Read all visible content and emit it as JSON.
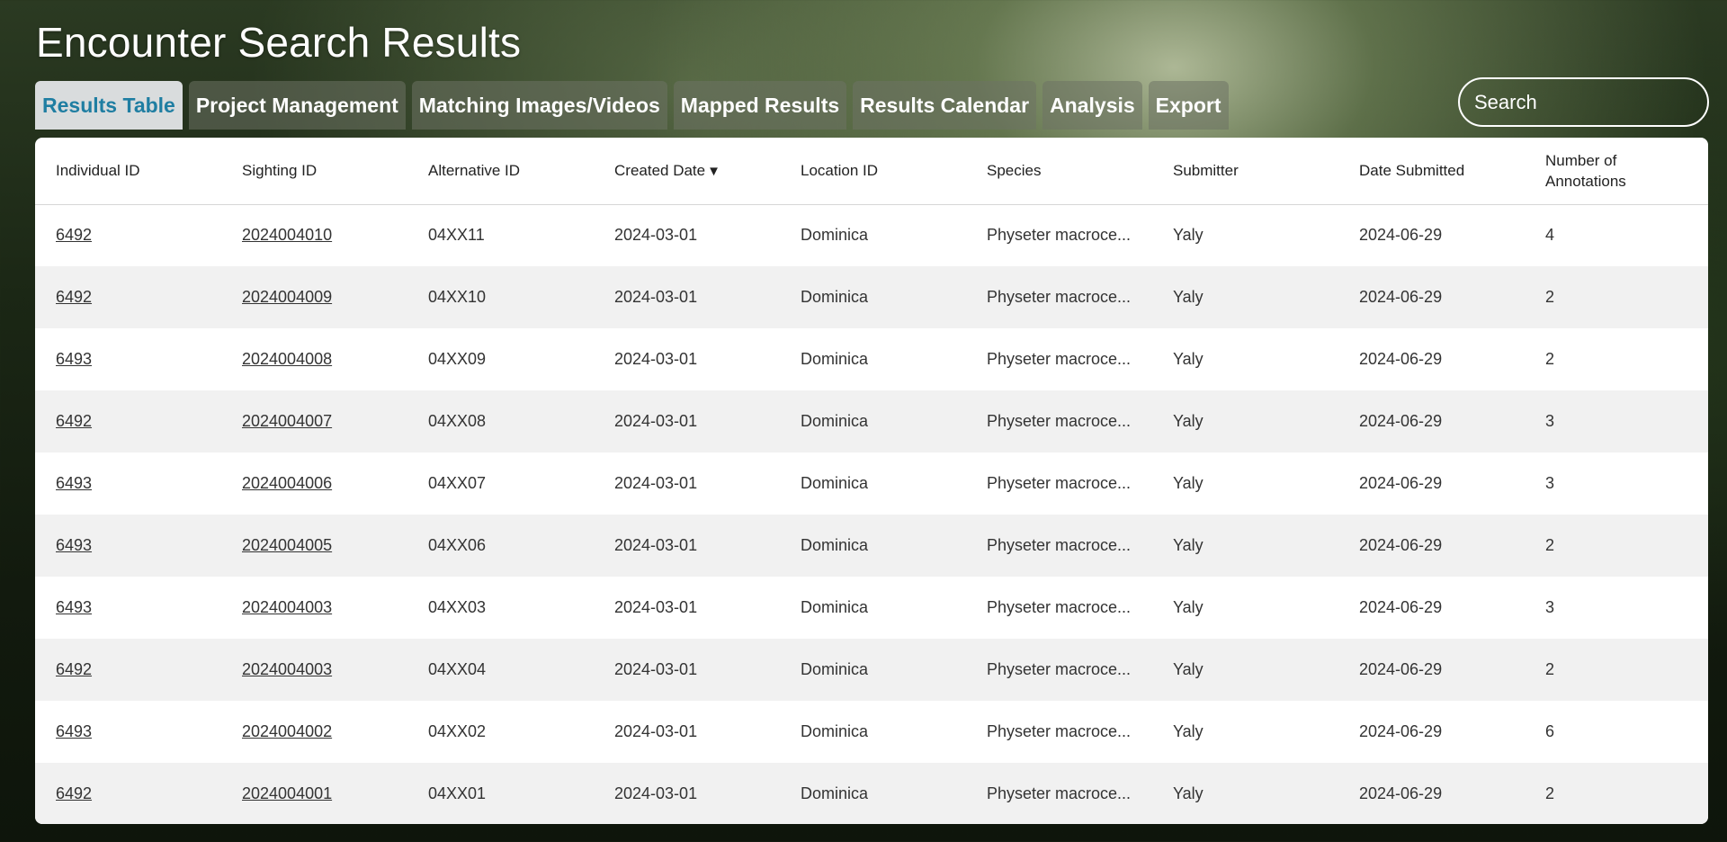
{
  "page": {
    "title": "Encounter Search Results"
  },
  "tabs": [
    {
      "label": "Results Table",
      "active": true
    },
    {
      "label": "Project Management"
    },
    {
      "label": "Matching Images/Videos"
    },
    {
      "label": "Mapped Results"
    },
    {
      "label": "Results Calendar"
    },
    {
      "label": "Analysis"
    },
    {
      "label": "Export"
    }
  ],
  "search": {
    "placeholder": "Search",
    "icon": "search-icon"
  },
  "table": {
    "headers": {
      "individual_id": "Individual ID",
      "sighting_id": "Sighting ID",
      "alternative_id": "Alternative ID",
      "created_date": "Created Date",
      "created_date_sort": "▼",
      "location_id": "Location ID",
      "species": "Species",
      "submitter": "Submitter",
      "date_submitted": "Date Submitted",
      "num_annotations_line1": "Number of",
      "num_annotations_line2": "Annotations"
    },
    "rows": [
      [
        "6492",
        "2024004010",
        "04XX11",
        "2024-03-01",
        "Dominica",
        "Physeter macroce...",
        "Yaly",
        "2024-06-29",
        "4"
      ],
      [
        "6492",
        "2024004009",
        "04XX10",
        "2024-03-01",
        "Dominica",
        "Physeter macroce...",
        "Yaly",
        "2024-06-29",
        "2"
      ],
      [
        "6493",
        "2024004008",
        "04XX09",
        "2024-03-01",
        "Dominica",
        "Physeter macroce...",
        "Yaly",
        "2024-06-29",
        "2"
      ],
      [
        "6492",
        "2024004007",
        "04XX08",
        "2024-03-01",
        "Dominica",
        "Physeter macroce...",
        "Yaly",
        "2024-06-29",
        "3"
      ],
      [
        "6493",
        "2024004006",
        "04XX07",
        "2024-03-01",
        "Dominica",
        "Physeter macroce...",
        "Yaly",
        "2024-06-29",
        "3"
      ],
      [
        "6493",
        "2024004005",
        "04XX06",
        "2024-03-01",
        "Dominica",
        "Physeter macroce...",
        "Yaly",
        "2024-06-29",
        "2"
      ],
      [
        "6493",
        "2024004003",
        "04XX03",
        "2024-03-01",
        "Dominica",
        "Physeter macroce...",
        "Yaly",
        "2024-06-29",
        "3"
      ],
      [
        "6492",
        "2024004003",
        "04XX04",
        "2024-03-01",
        "Dominica",
        "Physeter macroce...",
        "Yaly",
        "2024-06-29",
        "2"
      ],
      [
        "6493",
        "2024004002",
        "04XX02",
        "2024-03-01",
        "Dominica",
        "Physeter macroce...",
        "Yaly",
        "2024-06-29",
        "6"
      ],
      [
        "6492",
        "2024004001",
        "04XX01",
        "2024-03-01",
        "Dominica",
        "Physeter macroce...",
        "Yaly",
        "2024-06-29",
        "2"
      ]
    ]
  },
  "colors": {
    "active_tab_text": "#1f7ea2",
    "active_tab_bg": "#d9dcdd",
    "row_alt_bg": "#f1f1f1"
  }
}
